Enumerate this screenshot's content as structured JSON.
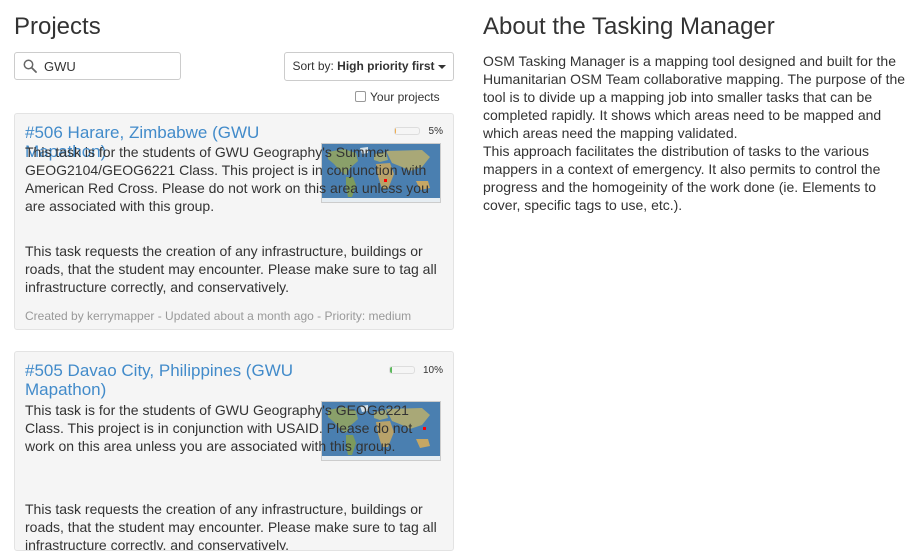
{
  "projects_panel": {
    "title": "Projects",
    "search": {
      "value": "GWU",
      "placeholder": ""
    },
    "sort": {
      "prefix": "Sort by: ",
      "value": "High priority first"
    },
    "your_projects_label": "Your projects",
    "your_projects_checked": false
  },
  "projects": [
    {
      "title": "#506 Harare, Zimbabwe (GWU Mapathon)",
      "progress_percent": 5,
      "progress_label": "5%",
      "progress_color": "#f0ad4e",
      "description": "This task is for the students of GWU Geography's Summer GEOG2104/GEOG6221 Class. This project is in conjunction with American Red Cross. Please do not work on this area unless you are associated with this group.",
      "instructions": "This task requests the creation of any infrastructure, buildings or roads, that the student may encounter. Please make sure to tag all infrastructure correctly, and conservatively.",
      "meta": "Created by kerrymapper - Updated about a month ago - Priority: medium"
    },
    {
      "title": "#505 Davao City, Philippines (GWU Mapathon)",
      "progress_percent": 10,
      "progress_label": "10%",
      "progress_color": "#5cb85c",
      "description": "This task is for the students of GWU Geography's GEOG6221 Class. This project is in conjunction with USAID. Please do not work on this area unless you are associated with this group.",
      "instructions": "This task requests the creation of any infrastructure, buildings or roads, that the student may encounter. Please make sure to tag all infrastructure correctly, and conservatively.",
      "meta": ""
    }
  ],
  "about": {
    "title": "About the Tasking Manager",
    "text_1": "OSM Tasking Manager is a mapping tool designed and built for the Humanitarian OSM Team collaborative mapping. The purpose of the tool is to divide up a mapping job into smaller tasks that can be completed rapidly. It shows which areas need to be mapped and which areas need the mapping validated.",
    "text_2": "This approach facilitates the distribution of tasks to the various mappers in a context of emergency. It also permits to control the progress and the homogeinity of the work done (ie. Elements to cover, specific tags to use, etc.)."
  },
  "icons": {
    "search": "search-icon",
    "sort_caret": "caret-down-icon",
    "checkbox": "checkbox-icon",
    "thumbnail": "world-map-thumbnail"
  }
}
